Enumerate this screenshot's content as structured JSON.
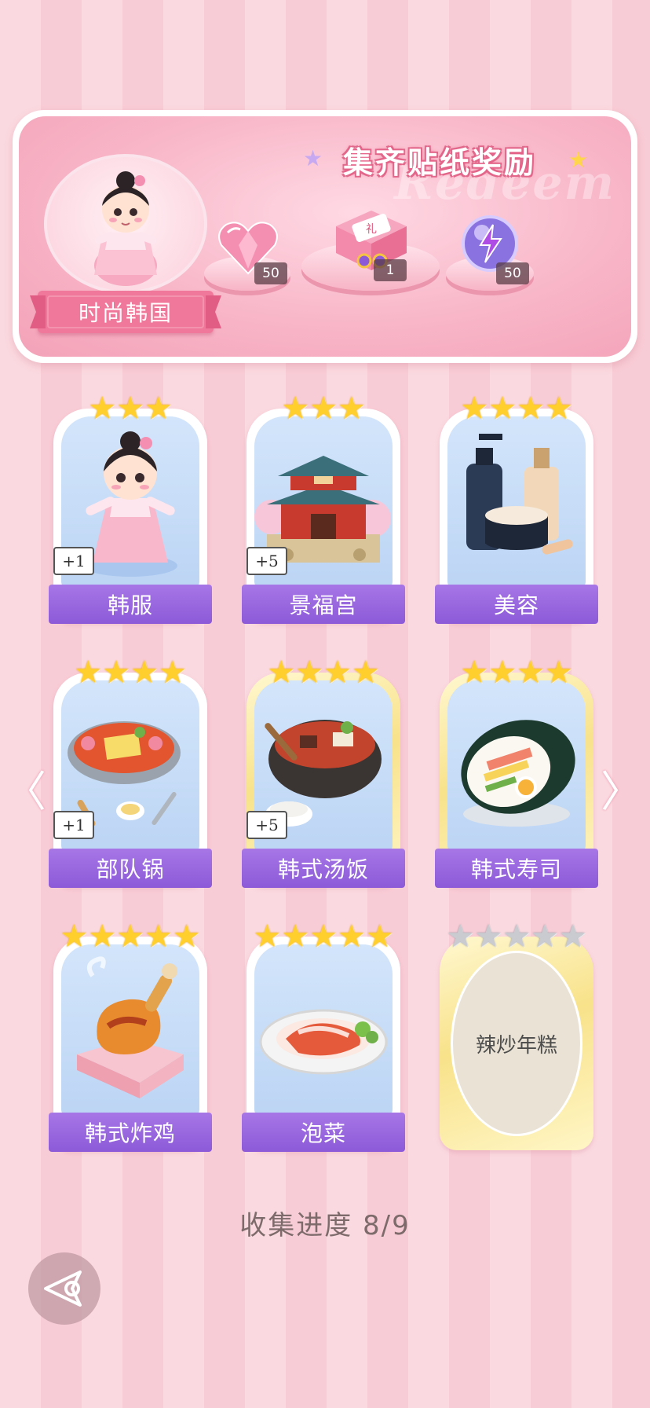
{
  "header": {
    "title": "集齐贴纸奖励",
    "watermark": "Redeem",
    "theme_label": "时尚韩国",
    "rewards": [
      {
        "icon": "pink-heart-gem-icon",
        "count": "50"
      },
      {
        "icon": "gift-box-icon",
        "count": "1"
      },
      {
        "icon": "lightning-orb-icon",
        "count": "50"
      }
    ]
  },
  "cards": [
    {
      "label": "韩服",
      "stars": 3,
      "bonus": "+1",
      "icon": "hanbok-girl-icon",
      "frame": "white"
    },
    {
      "label": "景福宫",
      "stars": 3,
      "bonus": "+5",
      "icon": "palace-icon",
      "frame": "white"
    },
    {
      "label": "美容",
      "stars": 4,
      "bonus": "",
      "icon": "cosmetics-icon",
      "frame": "white"
    },
    {
      "label": "部队锅",
      "stars": 4,
      "bonus": "+1",
      "icon": "army-stew-icon",
      "frame": "white"
    },
    {
      "label": "韩式汤饭",
      "stars": 4,
      "bonus": "+5",
      "icon": "soup-rice-icon",
      "frame": "gold"
    },
    {
      "label": "韩式寿司",
      "stars": 4,
      "bonus": "",
      "icon": "kimbap-icon",
      "frame": "gold"
    },
    {
      "label": "韩式炸鸡",
      "stars": 5,
      "bonus": "",
      "icon": "fried-chicken-icon",
      "frame": "white"
    },
    {
      "label": "泡菜",
      "stars": 5,
      "bonus": "",
      "icon": "kimchi-icon",
      "frame": "white"
    },
    {
      "label": "辣炒年糕",
      "stars": 5,
      "bonus": "",
      "icon": "locked-card",
      "frame": "gold",
      "locked": true
    }
  ],
  "navigation": {
    "prev_icon": "chevron-left-icon",
    "next_icon": "chevron-right-icon",
    "back_icon": "back-arrow-icon",
    "prev_glyph": "〈",
    "next_glyph": "〉"
  },
  "progress": {
    "label": "收集进度",
    "current": 8,
    "total": 9,
    "text": "收集进度  8/9"
  },
  "colors": {
    "background_pink": "#fbd9e0",
    "label_purple": "#9a66de",
    "star_gold": "#ffcf2e",
    "star_grey": "#c9cbd1",
    "ribbon_pink": "#f0789a"
  }
}
